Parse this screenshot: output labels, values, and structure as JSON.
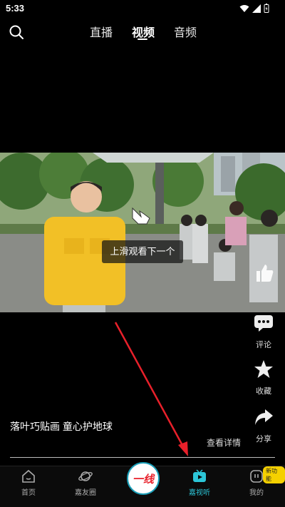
{
  "status_bar": {
    "time": "5:33"
  },
  "top_tabs": {
    "live": "直播",
    "video": "视频",
    "audio": "音频"
  },
  "video": {
    "hint": "上滑观看下一个",
    "title": "落叶巧贴画 童心护地球",
    "detail_link": "查看详情"
  },
  "side_actions": {
    "comment": "评论",
    "favorite": "收藏",
    "share": "分享"
  },
  "bottom_nav": {
    "home": "首页",
    "friends": "嘉友圈",
    "logo": "一线",
    "watch_listen": "嘉视听",
    "mine": "我的",
    "badge": "新功能"
  },
  "colors": {
    "accent": "#2cc6d8",
    "arrow": "#e8202a",
    "badge": "#f5d000"
  }
}
